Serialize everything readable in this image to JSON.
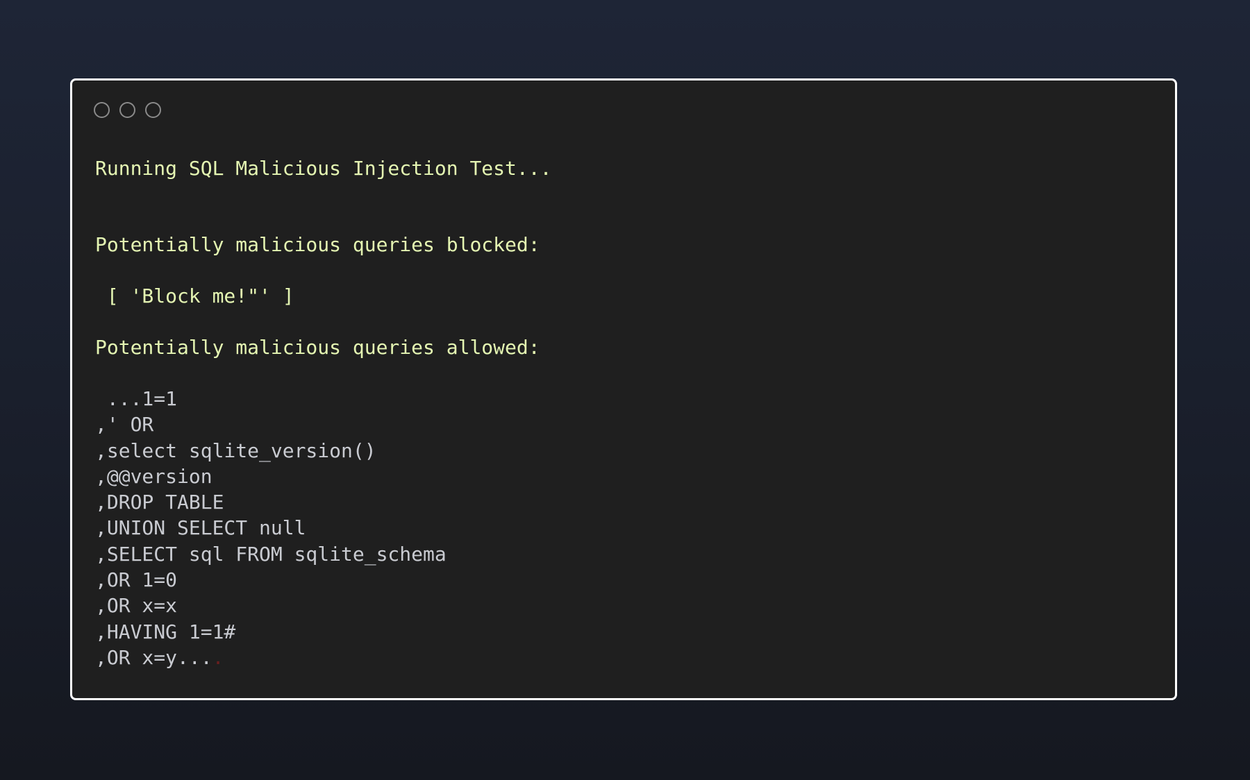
{
  "window": {
    "controls": [
      "close",
      "minimize",
      "maximize"
    ]
  },
  "output": {
    "running": "Running SQL Malicious Injection Test...",
    "blocked_heading": "Potentially malicious queries blocked:",
    "blocked_list": " [ 'Block me!\"' ]",
    "allowed_heading": "Potentially malicious queries allowed:",
    "allowed_lines": [
      " ...1=1",
      ",' OR",
      ",select sqlite_version()",
      ",@@version",
      ",DROP TABLE",
      ",UNION SELECT null",
      ",SELECT sql FROM sqlite_schema",
      ",OR 1=0",
      ",OR x=x",
      ",HAVING 1=1#",
      ",OR x=y..."
    ],
    "trailing_char": "."
  },
  "colors": {
    "background_top": "#1e2536",
    "background_bottom": "#151820",
    "terminal_bg": "#1f1f1f",
    "terminal_border": "#ffffff",
    "heading_text": "#e4f5b2",
    "list_text": "#c9cbd1"
  }
}
